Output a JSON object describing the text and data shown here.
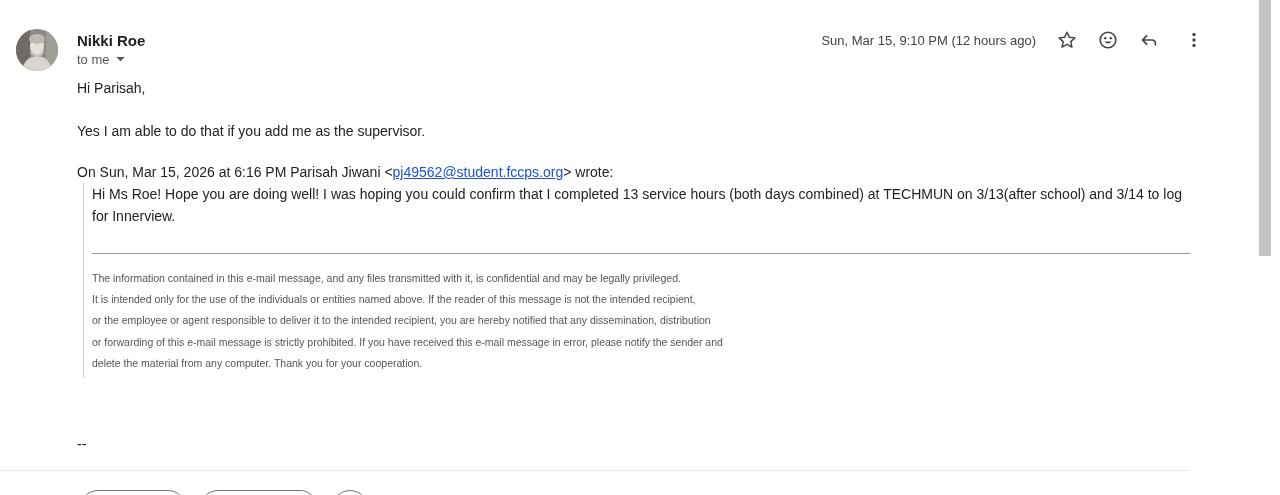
{
  "message": {
    "sender": "Nikki Roe",
    "recipient": "to me",
    "date": "Sun, Mar 15, 9:10 PM (12 hours ago)",
    "starred": false
  },
  "body": [
    "Hi Parisah,",
    "Yes I am able to do that if you add me as the supervisor."
  ],
  "quote": {
    "attribution_before": "On Sun, Mar 15, 2026 at 6:16 PM Parisah Jiwani <",
    "email": "pj49562@student.fccps.org",
    "attribution_after": "> wrote:",
    "text": "Hi Ms Roe! Hope you are doing well! I was hoping you could confirm that I completed 13 service hours (both days combined) at TECHMUN on 3/13(after school) and 3/14 to log for Innerview.",
    "disclaimer": [
      "The information contained in this e-mail message, and any files transmitted with it, is confidential and may be legally privileged.",
      "It is intended only for the use of the individuals or entities named above. If the reader of this message is not the intended recipient,",
      "or the employee or agent responsible to deliver it to the intended recipient, you are hereby notified that any dissemination, distribution",
      "or forwarding of this e-mail message is strictly prohibited. If you have received this e-mail message in error, please notify the sender and",
      "delete the material from any computer. Thank you for your cooperation."
    ]
  },
  "signature": "--",
  "footer_buttons": [
    {
      "kind": "wide"
    },
    {
      "kind": "wide"
    },
    {
      "kind": "round"
    }
  ]
}
